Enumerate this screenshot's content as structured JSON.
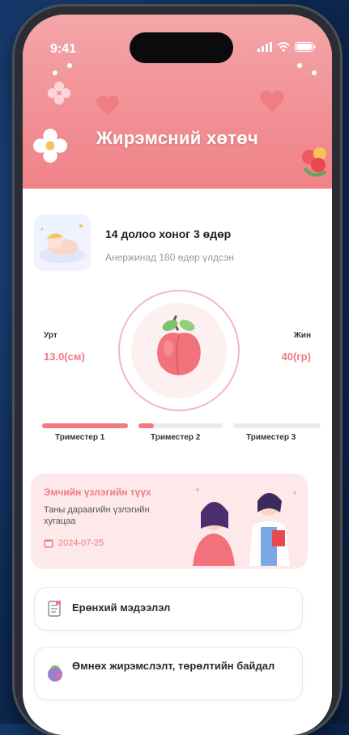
{
  "status_bar": {
    "time": "9:41"
  },
  "header": {
    "title": "Жирэмсний хөтөч"
  },
  "week_info": {
    "week_text": "14 долоо хоног 3 өдөр",
    "sub_text": "Анержинад 180 өдөр үлдсэн"
  },
  "metrics": {
    "length_label": "Урт",
    "length_value": "13.0(см)",
    "weight_label": "Жин",
    "weight_value": "40(гр)"
  },
  "trimesters": [
    {
      "label": "Триместер 1",
      "progress": 1.0
    },
    {
      "label": "Триместер 2",
      "progress": 0.15
    },
    {
      "label": "Триместер 3",
      "progress": 0.0
    }
  ],
  "history_card": {
    "title": "Эмчийн үзлэгийн түүх",
    "subtitle": "Таны дараагийн үзлэгийн хугацаа",
    "date": "2024-07-25"
  },
  "menu_items": [
    {
      "label": "Ерөнхий мэдээлэл",
      "icon": "document-icon"
    },
    {
      "label": "Өмнөх жирэмслэлт, төрөлтийн байдал",
      "icon": "pregnancy-icon"
    }
  ],
  "colors": {
    "accent": "#ef7a80",
    "header_bg": "#f18f94",
    "card_bg": "#fde9ea"
  }
}
